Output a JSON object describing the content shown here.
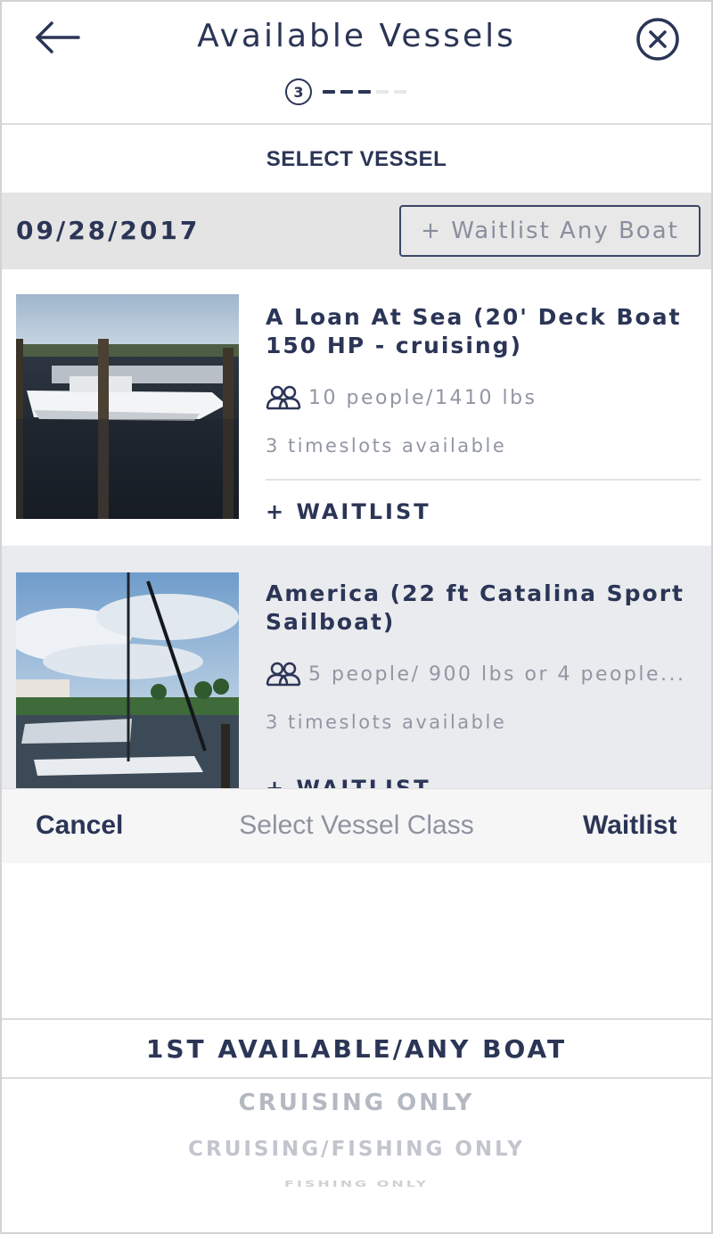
{
  "header": {
    "title": "Available Vessels",
    "step_number": "3",
    "back_icon": "arrow-left-icon",
    "close_icon": "close-circle-icon"
  },
  "section_label": "SELECT VESSEL",
  "date_bar": {
    "date": "09/28/2017",
    "waitlist_any_label": "+ Waitlist Any Boat"
  },
  "vessels": [
    {
      "name": "A Loan At Sea (20' Deck Boat 150 HP - cruising)",
      "capacity": "10 people/1410 lbs",
      "timeslots": "3 timeslots available",
      "waitlist_label": "+ WAITLIST"
    },
    {
      "name": "America (22 ft Catalina Sport Sailboat)",
      "capacity": "5 people/ 900 lbs or 4 people...",
      "timeslots": "3 timeslots available",
      "waitlist_label": "+ WAITLIST"
    }
  ],
  "picker": {
    "cancel_label": "Cancel",
    "title": "Select Vessel Class",
    "waitlist_label": "Waitlist",
    "options": [
      "1ST AVAILABLE/ANY BOAT",
      "CRUISING ONLY",
      "CRUISING/FISHING ONLY",
      "FISHING ONLY"
    ],
    "selected": "1ST AVAILABLE/ANY BOAT"
  },
  "colors": {
    "primary": "#2b3556",
    "muted": "#9196a3",
    "date_bar_bg": "#e4e4e4",
    "selected_card_bg": "#e9ebee"
  }
}
